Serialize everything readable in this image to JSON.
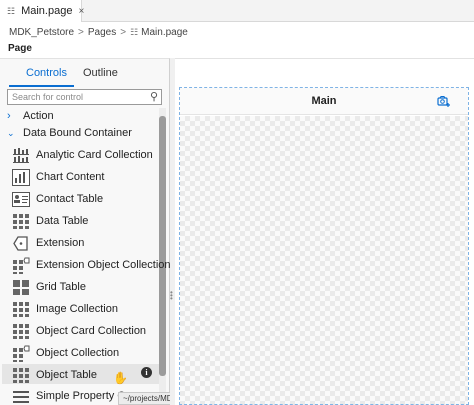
{
  "tab": {
    "label": "Main.page",
    "close": "×"
  },
  "breadcrumb": {
    "items": [
      "MDK_Petstore",
      "Pages",
      "Main.page"
    ],
    "sep": ">"
  },
  "section_label": "Page",
  "panel": {
    "tabs": {
      "controls": "Controls",
      "outline": "Outline"
    },
    "search_placeholder": "Search for control",
    "categories": [
      {
        "label": "Action",
        "expanded": false
      },
      {
        "label": "Data Bound Container",
        "expanded": true
      }
    ],
    "items": [
      {
        "label": "Analytic Card Collection",
        "icon": "analytic-card-icon"
      },
      {
        "label": "Chart Content",
        "icon": "chart-icon"
      },
      {
        "label": "Contact Table",
        "icon": "contact-table-icon"
      },
      {
        "label": "Data Table",
        "icon": "data-table-icon"
      },
      {
        "label": "Extension",
        "icon": "extension-icon"
      },
      {
        "label": "Extension Object Collection",
        "icon": "extension-collection-icon"
      },
      {
        "label": "Grid Table",
        "icon": "grid-table-icon"
      },
      {
        "label": "Image Collection",
        "icon": "image-collection-icon"
      },
      {
        "label": "Object Card Collection",
        "icon": "object-card-icon"
      },
      {
        "label": "Object Collection",
        "icon": "object-collection-icon"
      },
      {
        "label": "Object Table",
        "icon": "object-table-icon"
      },
      {
        "label": "Simple Property Co",
        "icon": "simple-property-icon"
      }
    ],
    "tooltip": "~/projects/MDK_Petstore",
    "info": "i"
  },
  "canvas": {
    "title": "Main"
  },
  "colors": {
    "accent": "#0a6ed1",
    "frame": "#7fb3e5"
  }
}
